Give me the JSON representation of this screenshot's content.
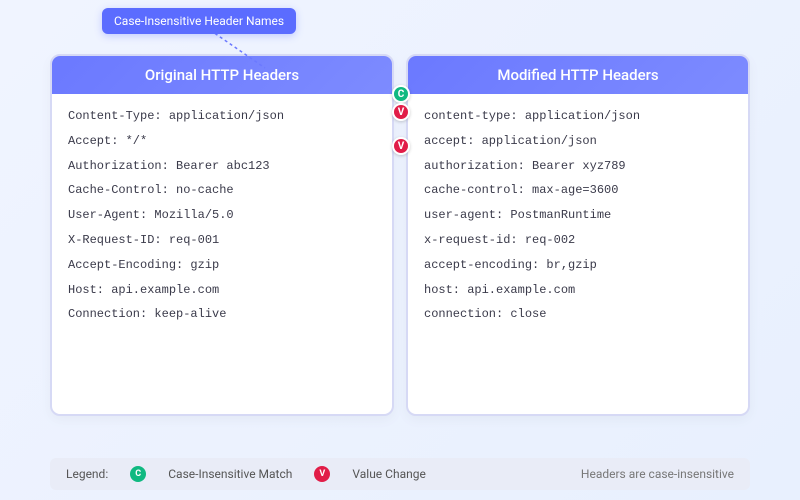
{
  "callout": {
    "text": "Case-Insensitive Header Names"
  },
  "panels": {
    "left": {
      "title": "Original HTTP Headers",
      "headers": [
        "Content-Type: application/json",
        "Accept: */*",
        "Authorization: Bearer abc123",
        "Cache-Control: no-cache",
        "User-Agent: Mozilla/5.0",
        "X-Request-ID: req-001",
        "Accept-Encoding: gzip",
        "Host: api.example.com",
        "Connection: keep-alive"
      ]
    },
    "right": {
      "title": "Modified HTTP Headers",
      "headers": [
        "content-type: application/json",
        "accept: application/json",
        "authorization: Bearer xyz789",
        "cache-control: max-age=3600",
        "user-agent: PostmanRuntime",
        "x-request-id: req-002",
        "accept-encoding: br,gzip",
        "host: api.example.com",
        "connection: close"
      ]
    }
  },
  "markers": {
    "c_label": "C",
    "v_label": "V"
  },
  "legend": {
    "label": "Legend:",
    "case_match": "Case-Insensitive Match",
    "value_change": "Value Change",
    "note": "Headers are case-insensitive"
  }
}
